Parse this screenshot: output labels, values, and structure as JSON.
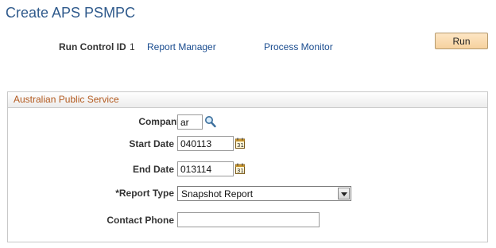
{
  "page": {
    "title": "Create APS PSMPC"
  },
  "run_control": {
    "label": "Run Control ID",
    "value": "1",
    "report_manager_link": "Report Manager",
    "process_monitor_link": "Process Monitor",
    "run_button": "Run"
  },
  "group": {
    "header": "Australian Public Service"
  },
  "form": {
    "company": {
      "label": "Company",
      "value": "ar"
    },
    "start_date": {
      "label": "Start Date",
      "value": "040113"
    },
    "end_date": {
      "label": "End Date",
      "value": "013114"
    },
    "report_type": {
      "label": "*Report Type",
      "selected": "Snapshot Report"
    },
    "contact_phone": {
      "label": "Contact Phone",
      "value": ""
    }
  },
  "icons": {
    "lookup": "magnifier-icon",
    "calendar": "calendar-icon"
  },
  "colors": {
    "title": "#2f5a8c",
    "link": "#1a4c8f",
    "group_header_text": "#b35a1f",
    "run_button_bg": "#f6d19e"
  }
}
